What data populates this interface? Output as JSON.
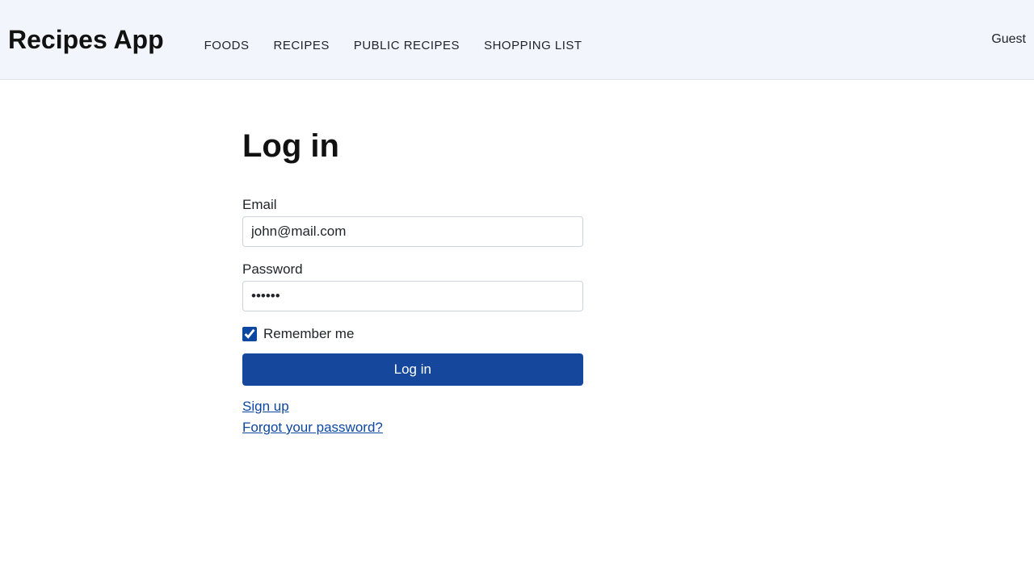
{
  "header": {
    "logo": "Recipes App",
    "nav": {
      "foods": "FOODS",
      "recipes": "RECIPES",
      "public_recipes": "PUBLIC RECIPES",
      "shopping_list": "SHOPPING LIST"
    },
    "user": "Guest"
  },
  "main": {
    "title": "Log in",
    "email_label": "Email",
    "email_value": "john@mail.com",
    "password_label": "Password",
    "password_value": "••••••",
    "remember_label": "Remember me",
    "remember_checked": true,
    "submit_label": "Log in",
    "signup_link": "Sign up",
    "forgot_link": "Forgot your password?"
  }
}
